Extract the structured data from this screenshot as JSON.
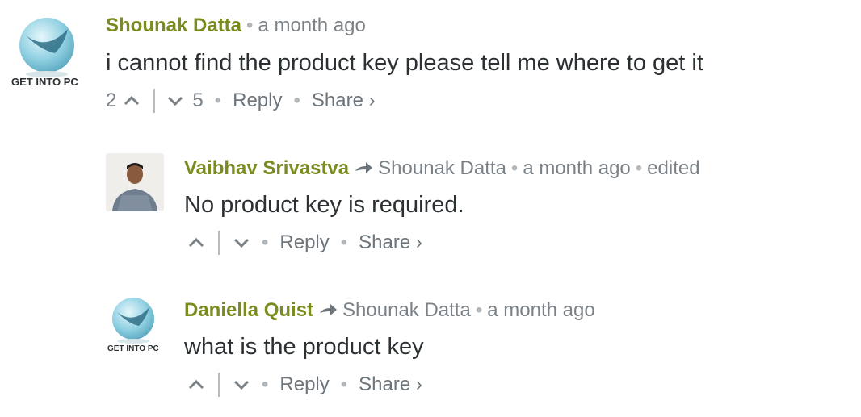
{
  "comments": [
    {
      "author": "Shounak Datta",
      "time": "a month ago",
      "text": "i cannot find the product key please tell me where to get it",
      "upvotes": "2",
      "downvotes": "5",
      "reply_label": "Reply",
      "share_label": "Share ›",
      "avatar_text": "GET INTO PC"
    },
    {
      "author": "Vaibhav Srivastva",
      "reply_to": "Shounak Datta",
      "time": "a month ago",
      "edited": "edited",
      "text": "No product key is required.",
      "reply_label": "Reply",
      "share_label": "Share ›"
    },
    {
      "author": "Daniella Quist",
      "reply_to": "Shounak Datta",
      "time": "a month ago",
      "text": "what is the product key",
      "reply_label": "Reply",
      "share_label": "Share ›",
      "avatar_text": "GET INTO PC"
    }
  ],
  "colors": {
    "author": "#7a8b1f",
    "meta": "#7a8288",
    "text": "#2b3033"
  },
  "icons": [
    "upvote-chevron-icon",
    "downvote-chevron-icon",
    "reply-arrow-icon"
  ]
}
